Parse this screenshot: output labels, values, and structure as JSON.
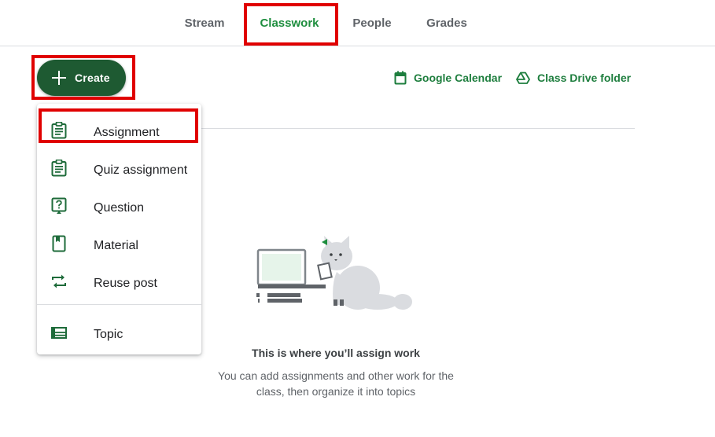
{
  "tabs": [
    {
      "label": "Stream"
    },
    {
      "label": "Classwork"
    },
    {
      "label": "People"
    },
    {
      "label": "Grades"
    }
  ],
  "active_tab": "Classwork",
  "toolbar": {
    "create_label": "Create",
    "calendar_link": "Google Calendar",
    "drive_link": "Class Drive folder"
  },
  "menu": {
    "items": [
      {
        "label": "Assignment",
        "icon": "assignment-icon"
      },
      {
        "label": "Quiz assignment",
        "icon": "quiz-assignment-icon"
      },
      {
        "label": "Question",
        "icon": "question-icon"
      },
      {
        "label": "Material",
        "icon": "material-icon"
      },
      {
        "label": "Reuse post",
        "icon": "reuse-post-icon"
      },
      {
        "label": "Topic",
        "icon": "topic-icon"
      }
    ]
  },
  "empty_state": {
    "title": "This is where you’ll assign work",
    "body": "You can add assignments and other work for the class, then organize it into topics"
  },
  "colors": {
    "accent_green": "#1e8e3e",
    "create_button": "#1e5a32",
    "highlight_box": "#e00000"
  }
}
